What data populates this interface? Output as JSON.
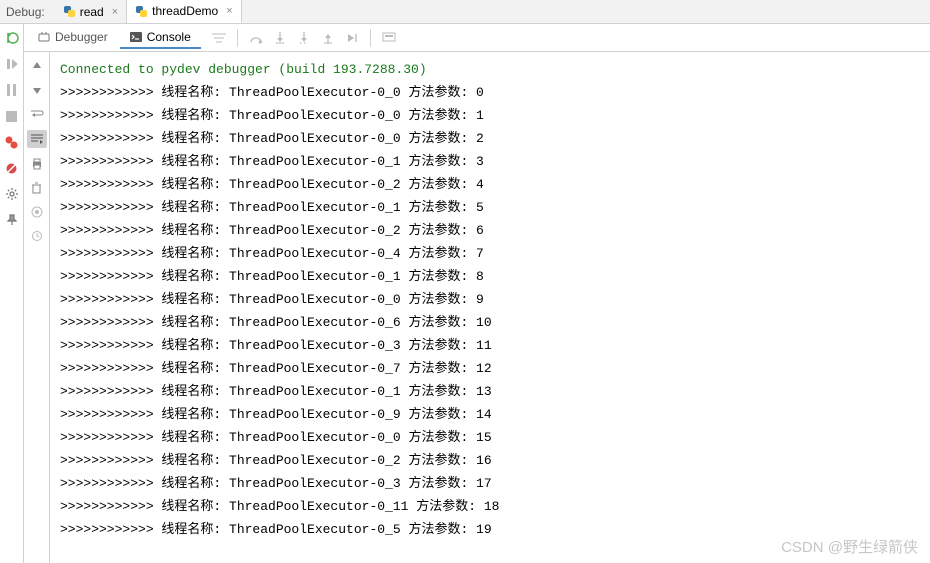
{
  "topBar": {
    "label": "Debug:",
    "tabs": [
      {
        "name": "read",
        "active": false
      },
      {
        "name": "threadDemo",
        "active": true
      }
    ]
  },
  "subToolbar": {
    "debuggerLabel": "Debugger",
    "consoleLabel": "Console"
  },
  "connectLine": "Connected to pydev debugger (build 193.7288.30)",
  "prefix": ">>>>>>>>>>>> ",
  "threadLabel": "线程名称: ",
  "paramLabel": " 方法参数: ",
  "rows": [
    {
      "thread": "ThreadPoolExecutor-0_0",
      "param": "0"
    },
    {
      "thread": "ThreadPoolExecutor-0_0",
      "param": "1"
    },
    {
      "thread": "ThreadPoolExecutor-0_0",
      "param": "2"
    },
    {
      "thread": "ThreadPoolExecutor-0_1",
      "param": "3"
    },
    {
      "thread": "ThreadPoolExecutor-0_2",
      "param": "4"
    },
    {
      "thread": "ThreadPoolExecutor-0_1",
      "param": "5"
    },
    {
      "thread": "ThreadPoolExecutor-0_2",
      "param": "6"
    },
    {
      "thread": "ThreadPoolExecutor-0_4",
      "param": "7"
    },
    {
      "thread": "ThreadPoolExecutor-0_1",
      "param": "8"
    },
    {
      "thread": "ThreadPoolExecutor-0_0",
      "param": "9"
    },
    {
      "thread": "ThreadPoolExecutor-0_6",
      "param": "10"
    },
    {
      "thread": "ThreadPoolExecutor-0_3",
      "param": "11"
    },
    {
      "thread": "ThreadPoolExecutor-0_7",
      "param": "12"
    },
    {
      "thread": "ThreadPoolExecutor-0_1",
      "param": "13"
    },
    {
      "thread": "ThreadPoolExecutor-0_9",
      "param": "14"
    },
    {
      "thread": "ThreadPoolExecutor-0_0",
      "param": "15"
    },
    {
      "thread": "ThreadPoolExecutor-0_2",
      "param": "16"
    },
    {
      "thread": "ThreadPoolExecutor-0_3",
      "param": "17"
    },
    {
      "thread": "ThreadPoolExecutor-0_11",
      "param": "18"
    },
    {
      "thread": "ThreadPoolExecutor-0_5",
      "param": "19"
    }
  ],
  "watermark": "CSDN @野生绿箭侠"
}
